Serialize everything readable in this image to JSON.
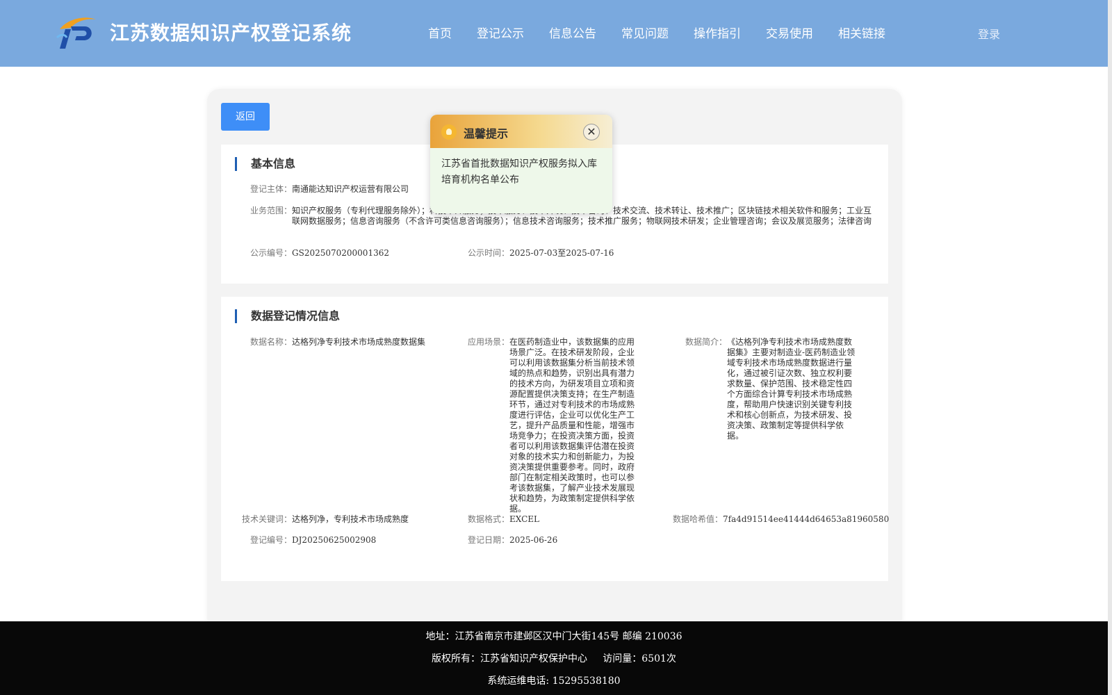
{
  "header": {
    "site_title": "江苏数据知识产权登记系统",
    "logo_icon": "ip-logo-icon",
    "nav": [
      "首页",
      "登记公示",
      "信息公告",
      "常见问题",
      "操作指引",
      "交易使用",
      "相关链接"
    ],
    "login_label": "登录"
  },
  "back_button": "返回",
  "basic_info": {
    "title": "基本信息",
    "subject_label": "登记主体：",
    "subject_value": "南通能达知识产权运营有限公司",
    "scope_label": "业务范围：",
    "scope_value": "知识产权服务（专利代理服务除外）；科技中介服务；技术服务、技术开发、技术咨询、技术交流、技术转让、技术推广；区块链技术相关软件和服务；工业互联网数据服务；信息咨询服务（不含许可类信息咨询服务）；信息技术咨询服务；技术推广服务；物联网技术研发；企业管理咨询；会议及展览服务；法律咨询",
    "notice_no_label": "公示编号：",
    "notice_no_value": "GS2025070200001362",
    "notice_time_label": "公示时间：",
    "notice_time_value": "2025-07-03至2025-07-16"
  },
  "data_info": {
    "title": "数据登记情况信息",
    "name_label": "数据名称：",
    "name_value": "达格列净专利技术市场成熟度数据集",
    "scene_label": "应用场景：",
    "scene_value": "在医药制造业中，该数据集的应用场景广泛。在技术研发阶段，企业可以利用该数据集分析当前技术领域的热点和趋势，识别出具有潜力的技术方向，为研发项目立项和资源配置提供决策支持；在生产制造环节，通过对专利技术的市场成熟度进行评估，企业可以优化生产工艺，提升产品质量和性能，增强市场竞争力；在投资决策方面，投资者可以利用该数据集评估潜在投资对象的技术实力和创新能力，为投资决策提供重要参考。同时，政府部门在制定相关政策时，也可以参考该数据集，了解产业技术发展现状和趋势，为政策制定提供科学依据。",
    "intro_label": "数据简介：",
    "intro_value": "《达格列净专利技术市场成熟度数据集》主要对制造业-医药制造业领域专利技术市场成熟度数据进行量化，通过被引证次数、独立权利要求数量、保护范围、技术稳定性四个方面综合计算专利技术市场成熟度，帮助用户快速识别关键专利技术和核心创新点，为技术研发、投资决策、政策制定等提供科学依据。",
    "keyword_label": "技术关键词：",
    "keyword_value": "达格列净，专利技术市场成熟度",
    "format_label": "数据格式：",
    "format_value": "EXCEL",
    "hash_label": "数据哈希值：",
    "hash_value": "7fa4d91514ee41444d64653a81960580",
    "reg_no_label": "登记编号：",
    "reg_no_value": "DJ20250625002908",
    "reg_date_label": "登记日期：",
    "reg_date_value": "2025-06-26"
  },
  "popup": {
    "icon": "lightbulb-icon",
    "title": "温馨提示",
    "close_icon": "close-icon",
    "message": "江苏省首批数据知识产权服务拟入库培育机构名单公布"
  },
  "footer": {
    "address": "地址：江苏省南京市建邺区汉中门大街145号 邮编 210036",
    "copyright": "版权所有：江苏省知识产权保护中心     访问量：6501次",
    "phone": "系统运维电话: 15295538180"
  },
  "colors": {
    "header_bg": "#7aa9de",
    "button_blue": "#3e8ef7",
    "title_bar": "#1f5fb3",
    "footer_bg": "#080808"
  }
}
